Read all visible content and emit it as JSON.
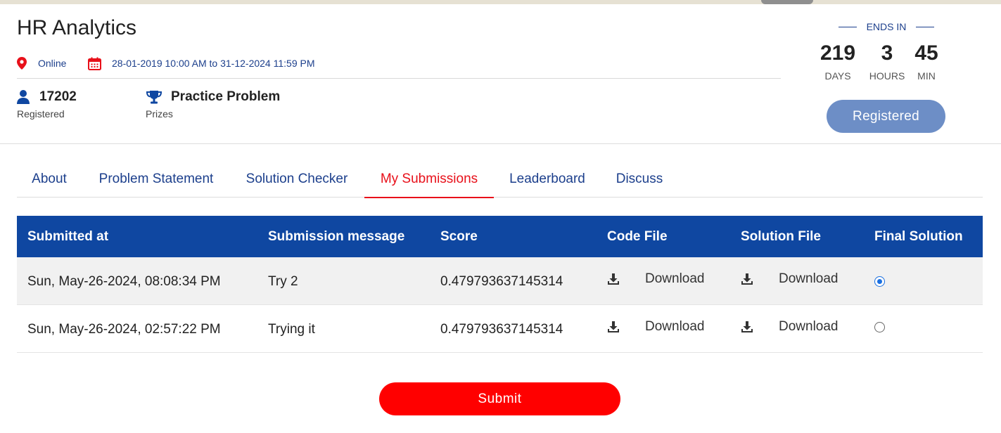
{
  "contest": {
    "title": "HR Analytics",
    "location": "Online",
    "dates": "28-01-2019 10:00 AM to 31-12-2024 11:59 PM",
    "registered_count": "17202",
    "registered_label": "Registered",
    "prize_value": "Practice Problem",
    "prize_label": "Prizes"
  },
  "countdown": {
    "ends_label": "ENDS IN",
    "days": "219",
    "days_label": "DAYS",
    "hours": "3",
    "hours_label": "HOURS",
    "minutes": "45",
    "minutes_label": "MIN",
    "status_button": "Registered"
  },
  "tabs": [
    {
      "label": "About"
    },
    {
      "label": "Problem Statement"
    },
    {
      "label": "Solution Checker"
    },
    {
      "label": "My Submissions",
      "active": true
    },
    {
      "label": "Leaderboard"
    },
    {
      "label": "Discuss"
    }
  ],
  "table": {
    "headers": [
      "Submitted at",
      "Submission message",
      "Score",
      "Code File",
      "Solution File",
      "Final Solution"
    ],
    "rows": [
      {
        "submitted_at": "Sun, May-26-2024, 08:08:34 PM",
        "message": "Try 2",
        "score": "0.479793637145314",
        "code_file": "Download",
        "solution_file": "Download",
        "final": true
      },
      {
        "submitted_at": "Sun, May-26-2024, 02:57:22 PM",
        "message": "Trying it",
        "score": "0.479793637145314",
        "code_file": "Download",
        "solution_file": "Download",
        "final": false
      }
    ]
  },
  "submit_button": "Submit",
  "icons": {
    "location": "map-pin-icon",
    "calendar": "calendar-icon",
    "user": "user-icon",
    "trophy": "trophy-icon",
    "download": "download-icon"
  },
  "colors": {
    "brand_blue": "#0f47a1",
    "link_blue": "#1c3f8c",
    "active_red": "#e8101a",
    "submit_red": "#ff0000",
    "registered_btn": "#6d8ec6"
  }
}
